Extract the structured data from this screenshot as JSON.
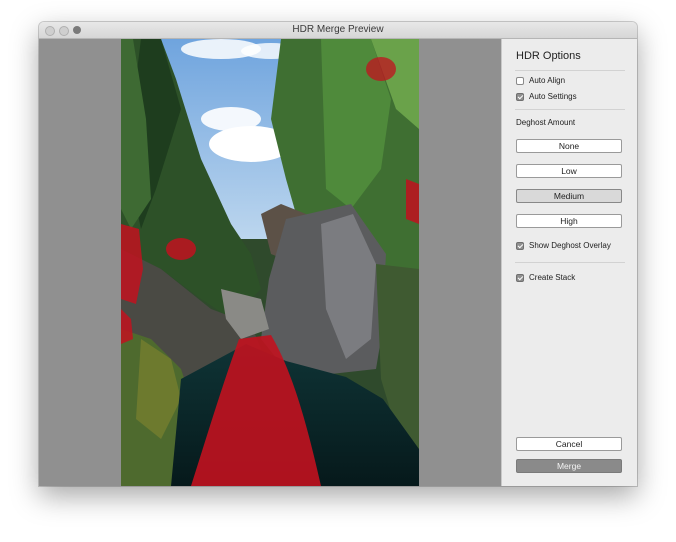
{
  "window": {
    "title": "HDR Merge Preview"
  },
  "sidebar": {
    "heading": "HDR Options",
    "auto_align": {
      "label": "Auto Align",
      "checked": false
    },
    "auto_settings": {
      "label": "Auto Settings",
      "checked": true
    },
    "deghost_label": "Deghost Amount",
    "deghost_options": [
      "None",
      "Low",
      "Medium",
      "High"
    ],
    "deghost_selected": "Medium",
    "show_overlay": {
      "label": "Show Deghost Overlay",
      "checked": true
    },
    "create_stack": {
      "label": "Create Stack",
      "checked": true
    },
    "cancel_label": "Cancel",
    "merge_label": "Merge"
  },
  "colors": {
    "deghost_overlay": "#c1121f",
    "accent_selected": "#d9d9d9"
  }
}
